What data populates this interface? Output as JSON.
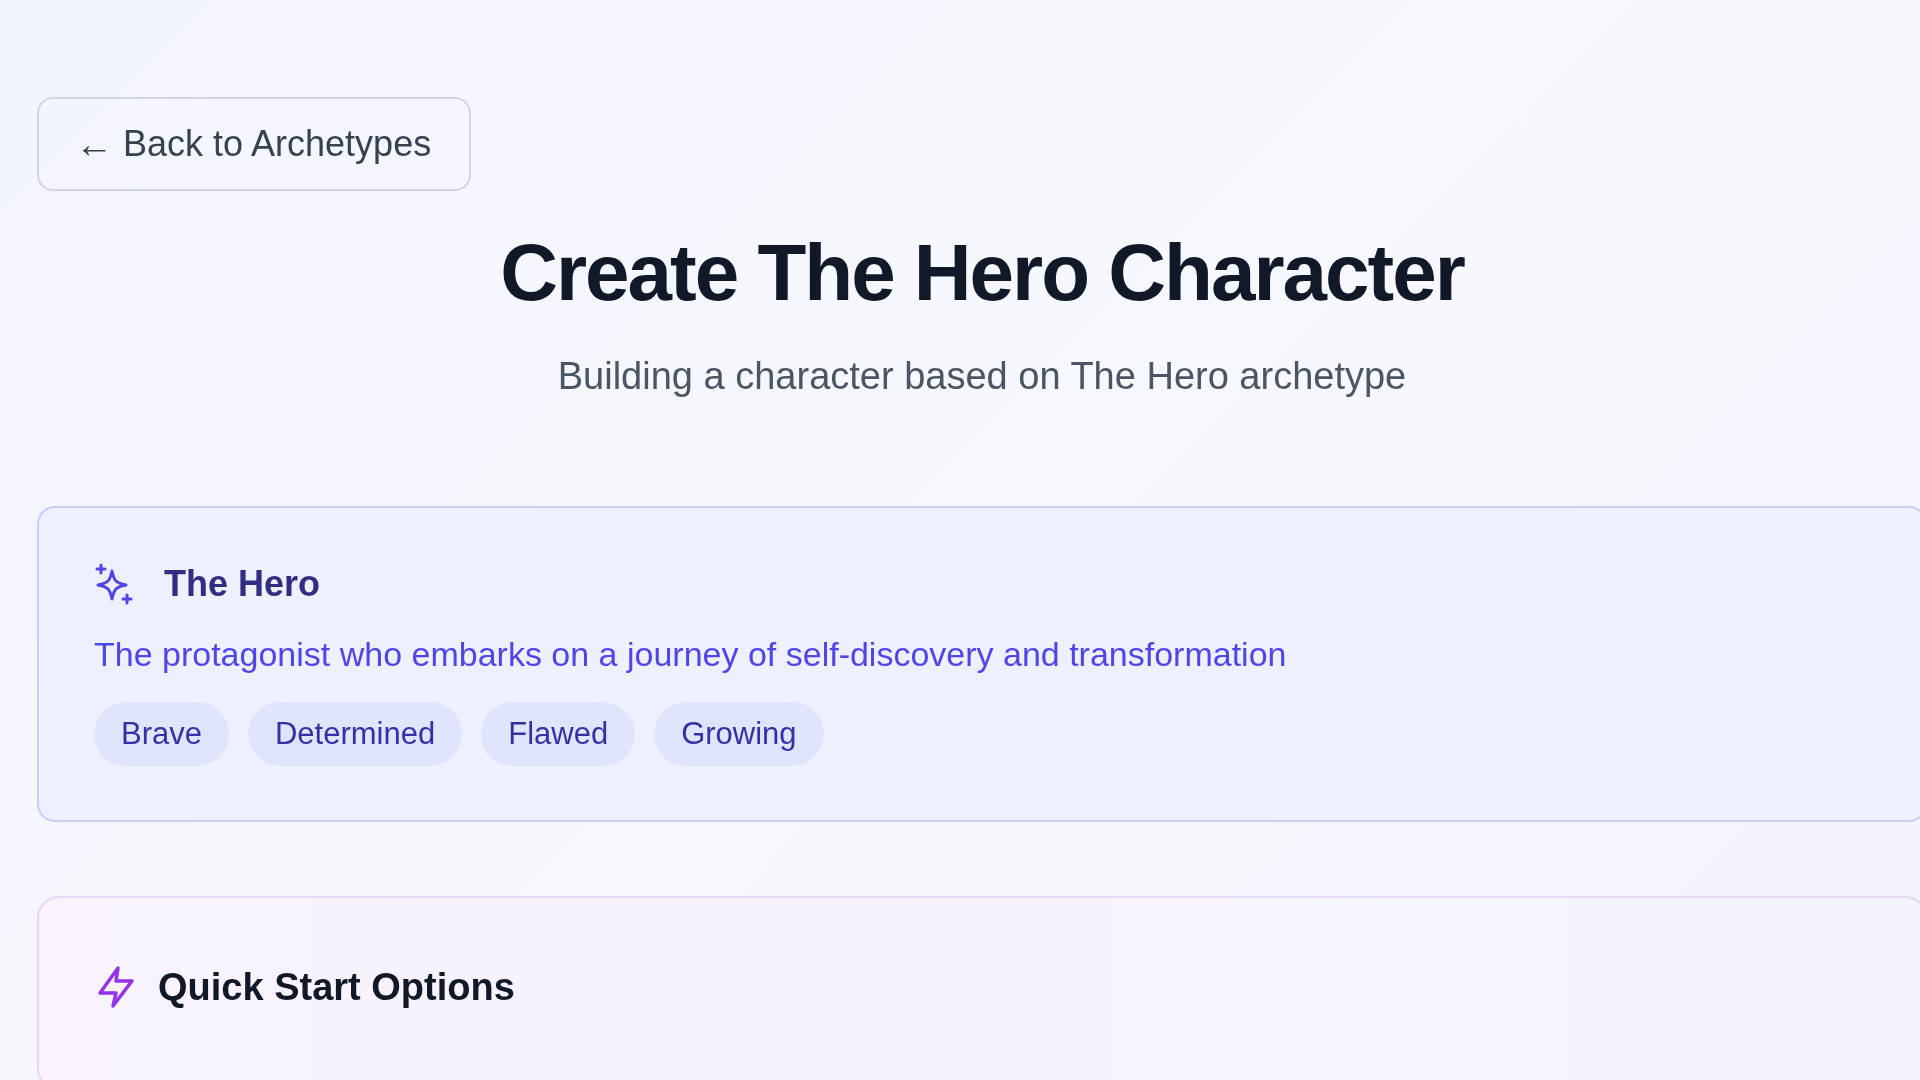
{
  "back_button": {
    "icon": "←",
    "label": "Back to Archetypes"
  },
  "title": "Create The Hero Character",
  "subtitle": "Building a character based on The Hero archetype",
  "archetype_card": {
    "name": "The Hero",
    "description": "The protagonist who embarks on a journey of self-discovery and transformation",
    "traits": [
      "Brave",
      "Determined",
      "Flawed",
      "Growing"
    ]
  },
  "quick_start": {
    "heading": "Quick Start Options"
  }
}
